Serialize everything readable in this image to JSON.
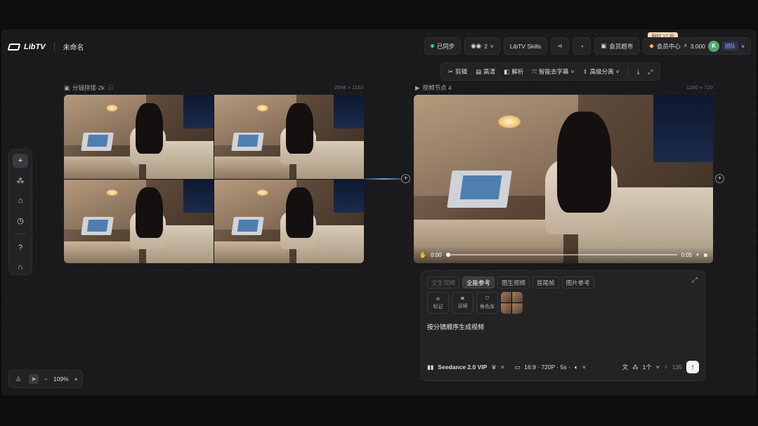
{
  "app": {
    "logo_text": "LibTV",
    "project_name": "未命名"
  },
  "topbar": {
    "sync_label": "已同步",
    "members_count": "2",
    "skills_label": "LibTV Skills",
    "store_label": "会员超市",
    "promo_badge": "限时 17 折",
    "vip_label": "会员中心",
    "credits": "3,000",
    "avatar_initial": "K",
    "team_label": "团队"
  },
  "toolbar": {
    "items": [
      "剪辑",
      "高清",
      "解析",
      "智能去字幕",
      "高级分离"
    ]
  },
  "nodes": {
    "image_node": {
      "title": "分镜拼接-2k",
      "dims": "2048 × 1152"
    },
    "video_node": {
      "title": "视频节点 4",
      "dims": "1280 × 720"
    }
  },
  "video": {
    "current_time": "0:00",
    "duration": "0:05"
  },
  "zoom": {
    "level": "109%",
    "minus": "−",
    "plus": "+"
  },
  "panel": {
    "tabs": [
      {
        "label": "文生视频",
        "state": "dim"
      },
      {
        "label": "全能参考",
        "state": "active"
      },
      {
        "label": "图生视频",
        "state": "normal"
      },
      {
        "label": "首尾帧",
        "state": "normal"
      },
      {
        "label": "图片参考",
        "state": "normal"
      }
    ],
    "ref_buttons": [
      "标记",
      "运镜",
      "角色库"
    ],
    "prompt_text": "按分镜顺序生成视频",
    "model": "Seedance 2.0 VIP",
    "settings": "16:9 · 720P · 5s · ",
    "count": "1个",
    "cost": "135"
  },
  "colors": {
    "canvas_bg": "#1a1a1c",
    "accent_green": "#3ecf6e",
    "connector": "#7aa0e0"
  }
}
